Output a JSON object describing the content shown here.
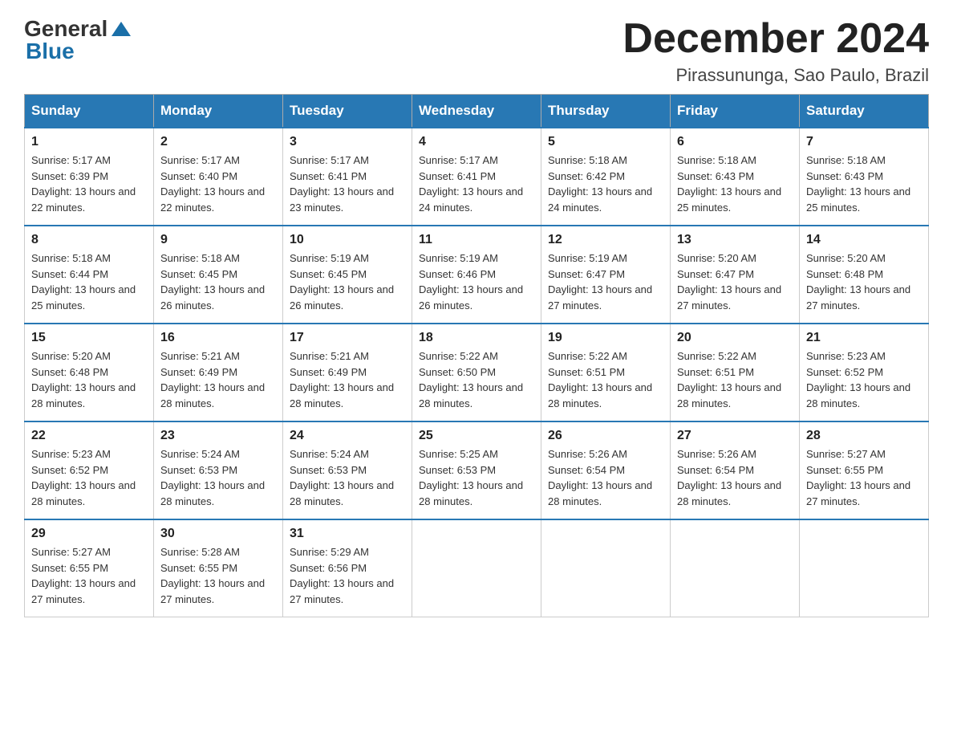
{
  "header": {
    "logo_general": "General",
    "logo_blue": "Blue",
    "month_title": "December 2024",
    "subtitle": "Pirassununga, Sao Paulo, Brazil"
  },
  "days_of_week": [
    "Sunday",
    "Monday",
    "Tuesday",
    "Wednesday",
    "Thursday",
    "Friday",
    "Saturday"
  ],
  "weeks": [
    [
      {
        "day": "1",
        "sunrise": "Sunrise: 5:17 AM",
        "sunset": "Sunset: 6:39 PM",
        "daylight": "Daylight: 13 hours and 22 minutes."
      },
      {
        "day": "2",
        "sunrise": "Sunrise: 5:17 AM",
        "sunset": "Sunset: 6:40 PM",
        "daylight": "Daylight: 13 hours and 22 minutes."
      },
      {
        "day": "3",
        "sunrise": "Sunrise: 5:17 AM",
        "sunset": "Sunset: 6:41 PM",
        "daylight": "Daylight: 13 hours and 23 minutes."
      },
      {
        "day": "4",
        "sunrise": "Sunrise: 5:17 AM",
        "sunset": "Sunset: 6:41 PM",
        "daylight": "Daylight: 13 hours and 24 minutes."
      },
      {
        "day": "5",
        "sunrise": "Sunrise: 5:18 AM",
        "sunset": "Sunset: 6:42 PM",
        "daylight": "Daylight: 13 hours and 24 minutes."
      },
      {
        "day": "6",
        "sunrise": "Sunrise: 5:18 AM",
        "sunset": "Sunset: 6:43 PM",
        "daylight": "Daylight: 13 hours and 25 minutes."
      },
      {
        "day": "7",
        "sunrise": "Sunrise: 5:18 AM",
        "sunset": "Sunset: 6:43 PM",
        "daylight": "Daylight: 13 hours and 25 minutes."
      }
    ],
    [
      {
        "day": "8",
        "sunrise": "Sunrise: 5:18 AM",
        "sunset": "Sunset: 6:44 PM",
        "daylight": "Daylight: 13 hours and 25 minutes."
      },
      {
        "day": "9",
        "sunrise": "Sunrise: 5:18 AM",
        "sunset": "Sunset: 6:45 PM",
        "daylight": "Daylight: 13 hours and 26 minutes."
      },
      {
        "day": "10",
        "sunrise": "Sunrise: 5:19 AM",
        "sunset": "Sunset: 6:45 PM",
        "daylight": "Daylight: 13 hours and 26 minutes."
      },
      {
        "day": "11",
        "sunrise": "Sunrise: 5:19 AM",
        "sunset": "Sunset: 6:46 PM",
        "daylight": "Daylight: 13 hours and 26 minutes."
      },
      {
        "day": "12",
        "sunrise": "Sunrise: 5:19 AM",
        "sunset": "Sunset: 6:47 PM",
        "daylight": "Daylight: 13 hours and 27 minutes."
      },
      {
        "day": "13",
        "sunrise": "Sunrise: 5:20 AM",
        "sunset": "Sunset: 6:47 PM",
        "daylight": "Daylight: 13 hours and 27 minutes."
      },
      {
        "day": "14",
        "sunrise": "Sunrise: 5:20 AM",
        "sunset": "Sunset: 6:48 PM",
        "daylight": "Daylight: 13 hours and 27 minutes."
      }
    ],
    [
      {
        "day": "15",
        "sunrise": "Sunrise: 5:20 AM",
        "sunset": "Sunset: 6:48 PM",
        "daylight": "Daylight: 13 hours and 28 minutes."
      },
      {
        "day": "16",
        "sunrise": "Sunrise: 5:21 AM",
        "sunset": "Sunset: 6:49 PM",
        "daylight": "Daylight: 13 hours and 28 minutes."
      },
      {
        "day": "17",
        "sunrise": "Sunrise: 5:21 AM",
        "sunset": "Sunset: 6:49 PM",
        "daylight": "Daylight: 13 hours and 28 minutes."
      },
      {
        "day": "18",
        "sunrise": "Sunrise: 5:22 AM",
        "sunset": "Sunset: 6:50 PM",
        "daylight": "Daylight: 13 hours and 28 minutes."
      },
      {
        "day": "19",
        "sunrise": "Sunrise: 5:22 AM",
        "sunset": "Sunset: 6:51 PM",
        "daylight": "Daylight: 13 hours and 28 minutes."
      },
      {
        "day": "20",
        "sunrise": "Sunrise: 5:22 AM",
        "sunset": "Sunset: 6:51 PM",
        "daylight": "Daylight: 13 hours and 28 minutes."
      },
      {
        "day": "21",
        "sunrise": "Sunrise: 5:23 AM",
        "sunset": "Sunset: 6:52 PM",
        "daylight": "Daylight: 13 hours and 28 minutes."
      }
    ],
    [
      {
        "day": "22",
        "sunrise": "Sunrise: 5:23 AM",
        "sunset": "Sunset: 6:52 PM",
        "daylight": "Daylight: 13 hours and 28 minutes."
      },
      {
        "day": "23",
        "sunrise": "Sunrise: 5:24 AM",
        "sunset": "Sunset: 6:53 PM",
        "daylight": "Daylight: 13 hours and 28 minutes."
      },
      {
        "day": "24",
        "sunrise": "Sunrise: 5:24 AM",
        "sunset": "Sunset: 6:53 PM",
        "daylight": "Daylight: 13 hours and 28 minutes."
      },
      {
        "day": "25",
        "sunrise": "Sunrise: 5:25 AM",
        "sunset": "Sunset: 6:53 PM",
        "daylight": "Daylight: 13 hours and 28 minutes."
      },
      {
        "day": "26",
        "sunrise": "Sunrise: 5:26 AM",
        "sunset": "Sunset: 6:54 PM",
        "daylight": "Daylight: 13 hours and 28 minutes."
      },
      {
        "day": "27",
        "sunrise": "Sunrise: 5:26 AM",
        "sunset": "Sunset: 6:54 PM",
        "daylight": "Daylight: 13 hours and 28 minutes."
      },
      {
        "day": "28",
        "sunrise": "Sunrise: 5:27 AM",
        "sunset": "Sunset: 6:55 PM",
        "daylight": "Daylight: 13 hours and 27 minutes."
      }
    ],
    [
      {
        "day": "29",
        "sunrise": "Sunrise: 5:27 AM",
        "sunset": "Sunset: 6:55 PM",
        "daylight": "Daylight: 13 hours and 27 minutes."
      },
      {
        "day": "30",
        "sunrise": "Sunrise: 5:28 AM",
        "sunset": "Sunset: 6:55 PM",
        "daylight": "Daylight: 13 hours and 27 minutes."
      },
      {
        "day": "31",
        "sunrise": "Sunrise: 5:29 AM",
        "sunset": "Sunset: 6:56 PM",
        "daylight": "Daylight: 13 hours and 27 minutes."
      },
      null,
      null,
      null,
      null
    ]
  ]
}
